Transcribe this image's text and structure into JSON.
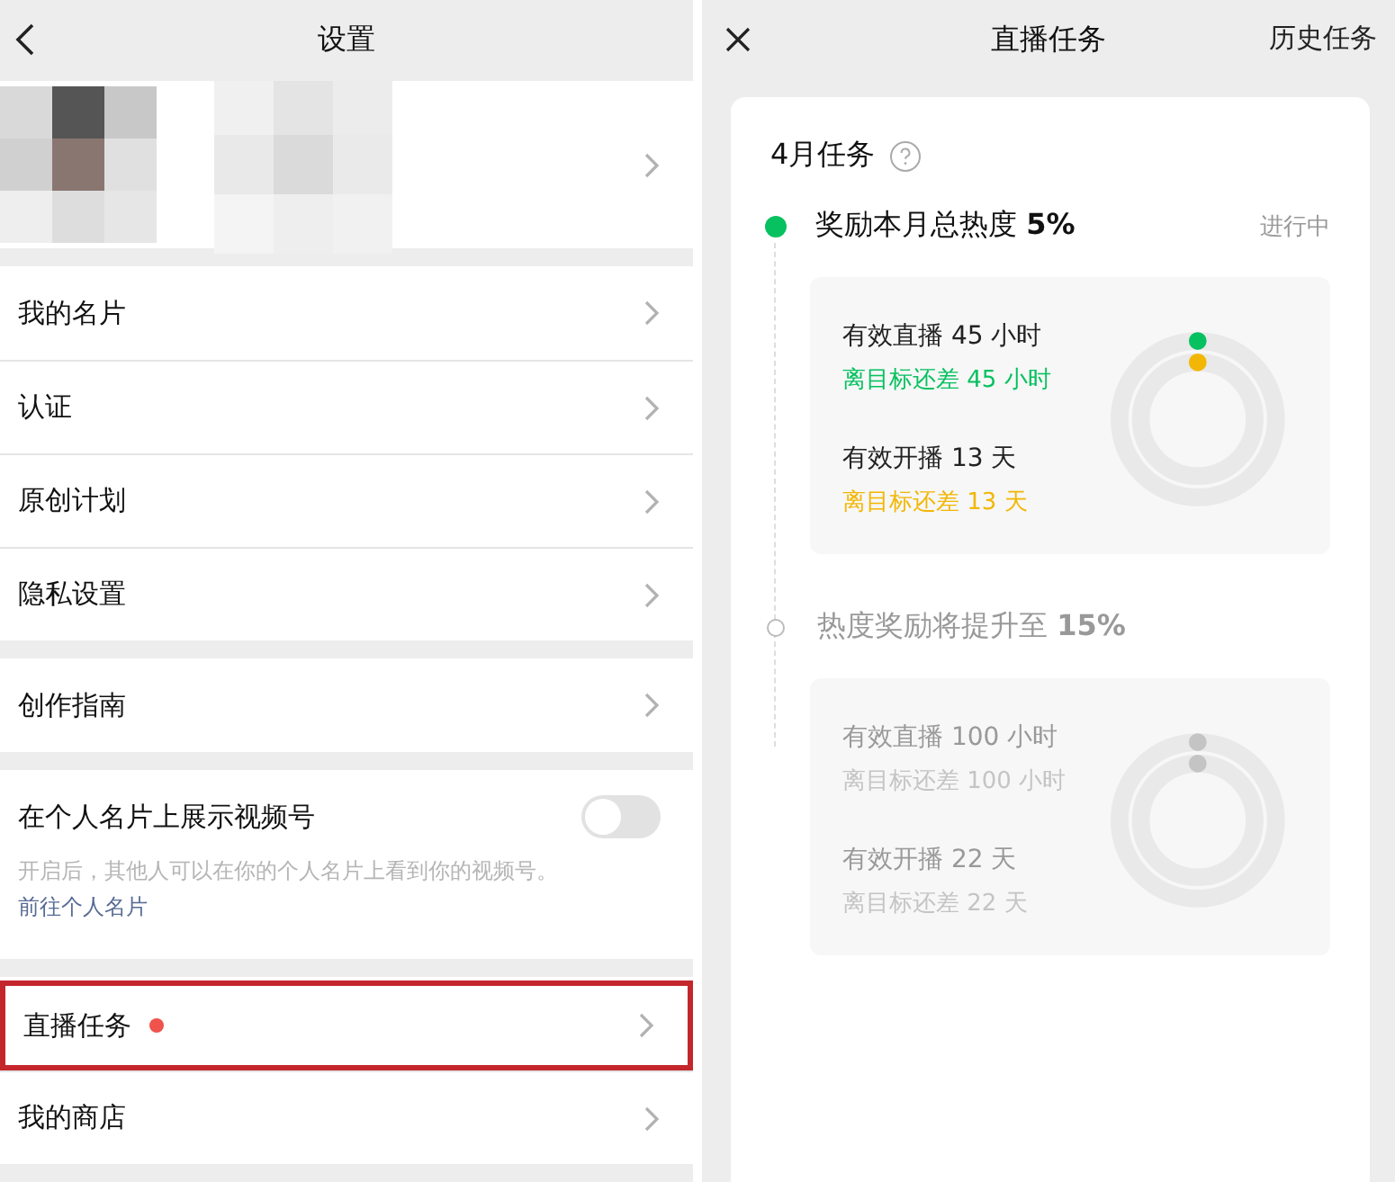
{
  "settings": {
    "title": "设置",
    "groups": [
      [
        {
          "kind": "profile"
        }
      ],
      [
        {
          "kind": "link",
          "label": "我的名片"
        },
        {
          "kind": "link",
          "label": "认证"
        },
        {
          "kind": "link",
          "label": "原创计划"
        },
        {
          "kind": "link",
          "label": "隐私设置"
        }
      ],
      [
        {
          "kind": "link",
          "label": "创作指南"
        }
      ],
      [
        {
          "kind": "toggle",
          "label": "在个人名片上展示视频号",
          "on": false,
          "description": "开启后，其他人可以在你的个人名片上看到你的视频号。",
          "link": "前往个人名片"
        }
      ],
      [
        {
          "kind": "link",
          "label": "直播任务",
          "badge": true,
          "highlighted": true
        },
        {
          "kind": "link",
          "label": "我的商店",
          "badge": false,
          "highlighted": false
        }
      ]
    ]
  },
  "live_tasks": {
    "title": "直播任务",
    "history_button": "历史任务",
    "month_title": "4月任务",
    "tiers": [
      {
        "active": true,
        "title": "奖励本月总热度 **5%**",
        "status": "进行中",
        "tasks": [
          {
            "label": "有效直播 45 小时",
            "remaining": "离目标还差 45 小时",
            "color": "#07c160"
          },
          {
            "label": "有效开播 13 天",
            "remaining": "离目标还差 13 天",
            "color": "#f2b705"
          }
        ]
      },
      {
        "active": false,
        "title": "热度奖励将提升至 **15%**",
        "tasks": [
          {
            "label": "有效直播 100 小时",
            "remaining": "离目标还差 100 小时",
            "color": "#c4c4c4"
          },
          {
            "label": "有效开播 22 天",
            "remaining": "离目标还差 22 天",
            "color": "#c4c4c4"
          }
        ]
      }
    ]
  }
}
